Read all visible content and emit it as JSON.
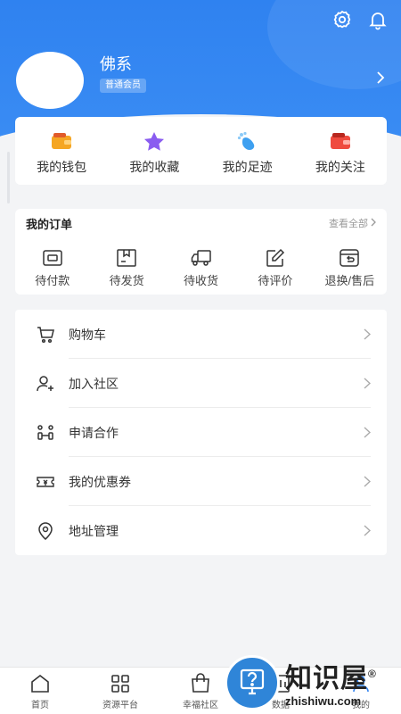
{
  "header": {
    "settings_icon": "gear-icon",
    "notification_icon": "bell-icon",
    "username": "佛系",
    "member_badge": "普通会员"
  },
  "quick_links": [
    {
      "label": "我的钱包",
      "icon": "wallet-icon",
      "color": "#f5a623"
    },
    {
      "label": "我的收藏",
      "icon": "star-icon",
      "color": "#8a5cf0"
    },
    {
      "label": "我的足迹",
      "icon": "footprint-icon",
      "color": "#3ea0f0"
    },
    {
      "label": "我的关注",
      "icon": "follow-icon",
      "color": "#ef4b3f"
    }
  ],
  "orders": {
    "title": "我的订单",
    "view_all": "查看全部",
    "items": [
      {
        "label": "待付款",
        "icon": "wallet-outline-icon"
      },
      {
        "label": "待发货",
        "icon": "package-icon"
      },
      {
        "label": "待收货",
        "icon": "truck-icon"
      },
      {
        "label": "待评价",
        "icon": "edit-icon"
      },
      {
        "label": "退换/售后",
        "icon": "return-icon"
      }
    ]
  },
  "menu": [
    {
      "label": "购物车",
      "icon": "cart-icon"
    },
    {
      "label": "加入社区",
      "icon": "add-user-icon"
    },
    {
      "label": "申请合作",
      "icon": "cooperation-icon"
    },
    {
      "label": "我的优惠券",
      "icon": "coupon-icon"
    },
    {
      "label": "地址管理",
      "icon": "location-icon"
    }
  ],
  "tabbar": [
    {
      "label": "首页",
      "icon": "home-icon"
    },
    {
      "label": "资源平台",
      "icon": "grid-icon"
    },
    {
      "label": "幸福社区",
      "icon": "bag-icon"
    },
    {
      "label": "数据",
      "icon": "chart-icon"
    },
    {
      "label": "我的",
      "icon": "user-icon"
    }
  ],
  "watermark": {
    "cn": "知识屋",
    "en": "zhishiwu.com",
    "symbol": "®"
  },
  "colors": {
    "primary": "#2f82f0",
    "background": "#f3f4f6"
  }
}
